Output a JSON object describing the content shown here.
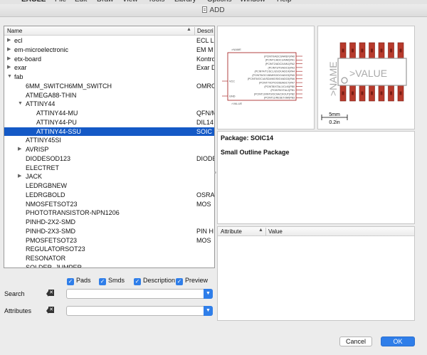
{
  "menubar": {
    "items": [
      "EAGLE",
      "File",
      "Edit",
      "Draw",
      "View",
      "Tools",
      "Library",
      "Options",
      "Window",
      "Help"
    ]
  },
  "window": {
    "title": "ADD"
  },
  "tree": {
    "columns": {
      "name": "Name",
      "description": "Descri"
    },
    "rows": [
      {
        "label": "ecl",
        "desc": "ECL L",
        "level": 0,
        "arrow": "right",
        "selected": false
      },
      {
        "label": "em-microelectronic",
        "desc": "EM M",
        "level": 0,
        "arrow": "right",
        "selected": false
      },
      {
        "label": "etx-board",
        "desc": "Kontro",
        "level": 0,
        "arrow": "right",
        "selected": false
      },
      {
        "label": "exar",
        "desc": "Exar D",
        "level": 0,
        "arrow": "right",
        "selected": false
      },
      {
        "label": "fab",
        "desc": "",
        "level": 0,
        "arrow": "down",
        "selected": false
      },
      {
        "label": "6MM_SWITCH6MM_SWITCH",
        "desc": "OMRO",
        "level": 1,
        "arrow": "",
        "selected": false
      },
      {
        "label": "ATMEGA88-THIN",
        "desc": "",
        "level": 1,
        "arrow": "",
        "selected": false
      },
      {
        "label": "ATTINY44",
        "desc": "",
        "level": 1,
        "arrow": "down",
        "selected": false
      },
      {
        "label": "ATTINY44-MU",
        "desc": "QFN/M",
        "level": 2,
        "arrow": "",
        "selected": false
      },
      {
        "label": "ATTINY44-PU",
        "desc": "DIL14",
        "level": 2,
        "arrow": "",
        "selected": false
      },
      {
        "label": "ATTINY44-SSU",
        "desc": "SOIC",
        "level": 2,
        "arrow": "",
        "selected": true
      },
      {
        "label": "ATTINY45SI",
        "desc": "",
        "level": 1,
        "arrow": "",
        "selected": false
      },
      {
        "label": "AVRISP",
        "desc": "",
        "level": 1,
        "arrow": "right",
        "selected": false
      },
      {
        "label": "DIODESOD123",
        "desc": "DIODE",
        "level": 1,
        "arrow": "",
        "selected": false
      },
      {
        "label": "ELECTRET",
        "desc": "",
        "level": 1,
        "arrow": "",
        "selected": false
      },
      {
        "label": "JACK",
        "desc": "",
        "level": 1,
        "arrow": "right",
        "selected": false
      },
      {
        "label": "LEDRGBNEW",
        "desc": "",
        "level": 1,
        "arrow": "",
        "selected": false
      },
      {
        "label": "LEDRGBOLD",
        "desc": "OSRA",
        "level": 1,
        "arrow": "",
        "selected": false
      },
      {
        "label": "NMOSFETSOT23",
        "desc": "MOS",
        "level": 1,
        "arrow": "",
        "selected": false
      },
      {
        "label": "PHOTOTRANSISTOR-NPN1206",
        "desc": "",
        "level": 1,
        "arrow": "",
        "selected": false
      },
      {
        "label": "PINHD-2X2-SMD",
        "desc": "",
        "level": 1,
        "arrow": "",
        "selected": false
      },
      {
        "label": "PINHD-2X3-SMD",
        "desc": "PIN H",
        "level": 1,
        "arrow": "",
        "selected": false
      },
      {
        "label": "PMOSFETSOT23",
        "desc": "MOS",
        "level": 1,
        "arrow": "",
        "selected": false
      },
      {
        "label": "REGULATORSOT23",
        "desc": "",
        "level": 1,
        "arrow": "",
        "selected": false
      },
      {
        "label": "RESONATOR",
        "desc": "",
        "level": 1,
        "arrow": "",
        "selected": false
      },
      {
        "label": "SOLDER_JUMPER",
        "desc": "",
        "level": 1,
        "arrow": "",
        "selected": false
      }
    ]
  },
  "options": {
    "pads": {
      "label": "Pads",
      "checked": true
    },
    "smds": {
      "label": "Smds",
      "checked": true
    },
    "description": {
      "label": "Description",
      "checked": true
    },
    "preview": {
      "label": "Preview",
      "checked": true
    }
  },
  "search": {
    "label": "Search",
    "value": ""
  },
  "attributes": {
    "label": "Attributes",
    "value": ""
  },
  "symbol": {
    "pins_right": [
      "(PCINT0/ADC0/AREF)PA0",
      "(PCINT1/ADC1/AIN0)PA1",
      "(PCINT2/ADC2/AIN1)PA2",
      "(PCINT3/T0/ADC3)PA3",
      "(PCINT4/T1/SCL/USCK/ADC4)PA4",
      "(PCINT5/OC1B/MISO/DO/ADC5)PA5",
      "(PCINT6/OC1A/SDA/MOSI/DI/ADC6)PA6",
      "(PCINT7/ICP/OC0B/ADC7)PA7",
      "(PCINT8/XTAL1/CLKI)PB0",
      "(PCINT9/XTAL2)PB1",
      "(PCINT10/INT0/OC0A/CKOUT)PB2",
      "(PCINT11/RESET/dW)PB3"
    ],
    "pins_left": [
      "VCC",
      "GND"
    ],
    "name_label": ">NAME",
    "value_label": ">VALUE"
  },
  "package_preview": {
    "name_label": ">NAME",
    "value_label": ">VALUE",
    "scale_mm": "5mm",
    "scale_in": "0.2in"
  },
  "info": {
    "package": "Package: SOIC14",
    "description": "Small Outline Package"
  },
  "attr_table": {
    "col_attribute": "Attribute",
    "col_value": "Value"
  },
  "buttons": {
    "cancel": "Cancel",
    "ok": "OK"
  }
}
